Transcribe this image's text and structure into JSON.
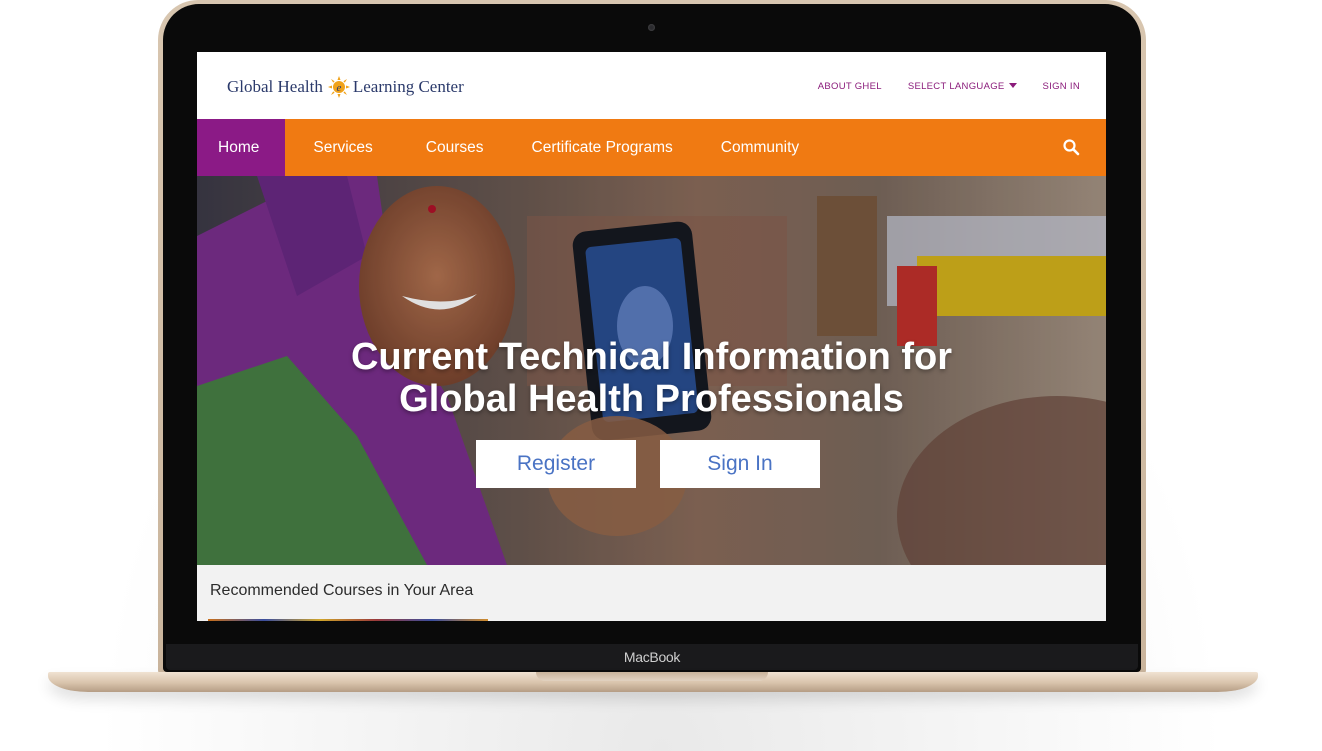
{
  "device": {
    "brand_label": "MacBook"
  },
  "header": {
    "logo_text_left": "Global Health",
    "logo_text_right": "Learning Center",
    "util_links": {
      "about": "ABOUT GHEL",
      "language": "SELECT LANGUAGE",
      "signin": "SIGN IN"
    }
  },
  "nav": {
    "items": [
      {
        "label": "Home"
      },
      {
        "label": "Services"
      },
      {
        "label": "Courses"
      },
      {
        "label": "Certificate Programs"
      },
      {
        "label": "Community"
      }
    ],
    "search_icon": "search-icon"
  },
  "hero": {
    "headline_line1": "Current Technical Information for",
    "headline_line2": "Global Health Professionals",
    "register_label": "Register",
    "signin_label": "Sign In"
  },
  "recommended": {
    "title": "Recommended Courses in Your Area"
  },
  "colors": {
    "nav_orange": "#f07a12",
    "active_purple": "#8b1a86",
    "link_purple": "#8b1c7b",
    "button_blue_text": "#4a73c4",
    "logo_navy": "#2b3a6b"
  }
}
